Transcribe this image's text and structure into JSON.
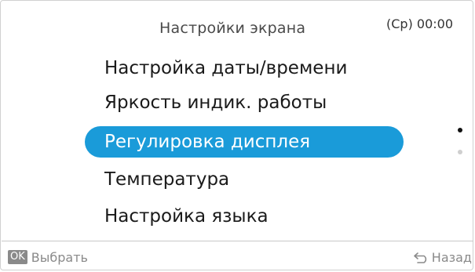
{
  "header": {
    "title": "Настройки экрана",
    "clock": "(Ср) 00:00"
  },
  "menu": {
    "items": [
      {
        "label": "Настройка даты/времени",
        "selected": false
      },
      {
        "label": "Яркость индик. работы",
        "selected": false
      },
      {
        "label": "Регулировка дисплея",
        "selected": true
      },
      {
        "label": "Температура",
        "selected": false
      },
      {
        "label": "Настройка языка",
        "selected": false
      }
    ]
  },
  "scroll": {
    "page": 1,
    "pages": 2
  },
  "footer": {
    "ok_badge": "OK",
    "select_label": "Выбрать",
    "back_label": "Назад",
    "back_icon": "back-arrow-icon"
  },
  "colors": {
    "accent": "#1a9bd9",
    "muted": "#8a8a8a"
  }
}
